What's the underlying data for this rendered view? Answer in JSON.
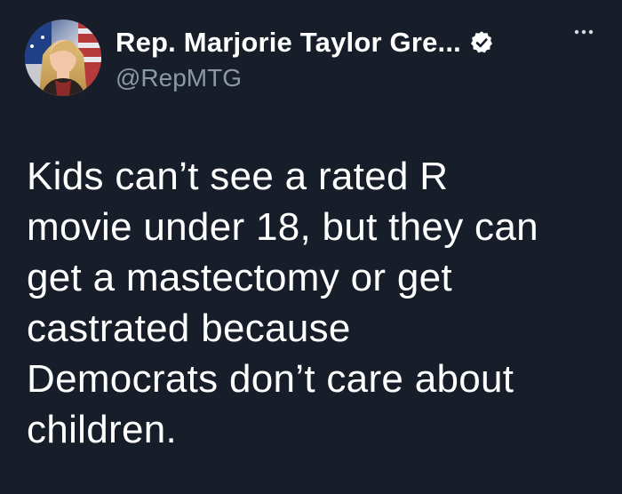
{
  "author": {
    "display_name": "Rep. Marjorie Taylor Gre...",
    "handle": "@RepMTG",
    "verified": true,
    "avatar_icon": "profile-photo",
    "verified_icon": "verified-check-icon",
    "more_icon": "more-horizontal-icon"
  },
  "tweet": {
    "lines": [
      "Kids can’t see a rated R",
      "movie under 18, but they can",
      "get a mastectomy or get",
      "castrated because",
      "Democrats don’t care about",
      "children."
    ]
  },
  "colors": {
    "background": "#171e2a",
    "text_primary": "#ffffff",
    "text_secondary": "#8b98a5"
  }
}
